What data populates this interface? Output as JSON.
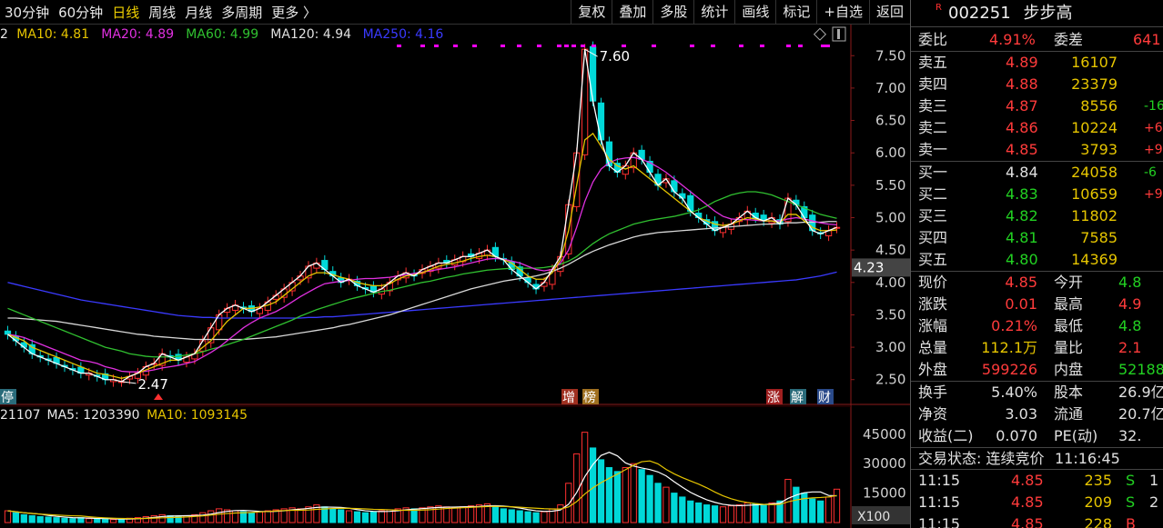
{
  "periods": [
    {
      "label": "30分钟",
      "active": false
    },
    {
      "label": "60分钟",
      "active": false
    },
    {
      "label": "日线",
      "active": true
    },
    {
      "label": "周线",
      "active": false
    },
    {
      "label": "月线",
      "active": false
    },
    {
      "label": "多周期",
      "active": false
    },
    {
      "label": "更多 〉",
      "active": false
    }
  ],
  "toolbar": [
    "复权",
    "叠加",
    "多股",
    "统计",
    "画线",
    "标记",
    "+自选",
    "返回"
  ],
  "ma_legend": [
    {
      "text": "2",
      "color": "#e8e8e8"
    },
    {
      "text": "MA10: 4.81",
      "color": "#e6c500"
    },
    {
      "text": "MA20: 4.89",
      "color": "#e030e0"
    },
    {
      "text": "MA60: 4.99",
      "color": "#30c030"
    },
    {
      "text": "MA120: 4.94",
      "color": "#e0e0e0"
    },
    {
      "text": "MA250: 4.16",
      "color": "#3a3aff"
    }
  ],
  "vol_legend": [
    {
      "text": "21107",
      "color": "#e8e8e8"
    },
    {
      "text": "MA5: 1203390",
      "color": "#e8e8e8"
    },
    {
      "text": "MA10: 1093145",
      "color": "#e6c500"
    }
  ],
  "price_axis": [
    "7.50",
    "7.00",
    "6.50",
    "6.00",
    "5.50",
    "5.00",
    "4.50",
    "4.00",
    "3.50",
    "3.00",
    "2.50"
  ],
  "current_marker": "4.23",
  "vol_axis": [
    "45000",
    "30000",
    "15000"
  ],
  "vol_unit": "X100",
  "annotations": {
    "high": "7.60",
    "low": "2.47",
    "events": [
      "停",
      "增",
      "榜",
      "涨",
      "解",
      "财"
    ]
  },
  "stock": {
    "code": "002251",
    "name": "步步高",
    "badge": "R"
  },
  "order_book": {
    "ratio_label": "委比",
    "ratio_value": "4.91%",
    "diff_label": "委差",
    "diff_value": "641",
    "asks": [
      {
        "label": "卖五",
        "price": "4.89",
        "vol": "16107",
        "chg": ""
      },
      {
        "label": "卖四",
        "price": "4.88",
        "vol": "23379",
        "chg": ""
      },
      {
        "label": "卖三",
        "price": "4.87",
        "vol": "8556",
        "chg": "-16"
      },
      {
        "label": "卖二",
        "price": "4.86",
        "vol": "10224",
        "chg": "+6"
      },
      {
        "label": "卖一",
        "price": "4.85",
        "vol": "3793",
        "chg": "+9"
      }
    ],
    "bids": [
      {
        "label": "买一",
        "price": "4.84",
        "vol": "24058",
        "chg": "-6"
      },
      {
        "label": "买二",
        "price": "4.83",
        "vol": "10659",
        "chg": "+9"
      },
      {
        "label": "买三",
        "price": "4.82",
        "vol": "11802",
        "chg": ""
      },
      {
        "label": "买四",
        "price": "4.81",
        "vol": "7585",
        "chg": ""
      },
      {
        "label": "买五",
        "price": "4.80",
        "vol": "14369",
        "chg": ""
      }
    ]
  },
  "quote": [
    {
      "l1": "现价",
      "v1": "4.85",
      "c1": "red",
      "l2": "今开",
      "v2": "4.8",
      "c2": "green"
    },
    {
      "l1": "涨跌",
      "v1": "0.01",
      "c1": "red",
      "l2": "最高",
      "v2": "4.9",
      "c2": "red"
    },
    {
      "l1": "涨幅",
      "v1": "0.21%",
      "c1": "red",
      "l2": "最低",
      "v2": "4.8",
      "c2": "green"
    },
    {
      "l1": "总量",
      "v1": "112.1万",
      "c1": "yellow",
      "l2": "量比",
      "v2": "2.1",
      "c2": "red"
    },
    {
      "l1": "外盘",
      "v1": "599226",
      "c1": "red",
      "l2": "内盘",
      "v2": "52188",
      "c2": "green"
    }
  ],
  "fundamentals": [
    {
      "l1": "换手",
      "v1": "5.40%",
      "l2": "股本",
      "v2": "26.9亿"
    },
    {
      "l1": "净资",
      "v1": "3.03",
      "l2": "流通",
      "v2": "20.7亿"
    },
    {
      "l1": "收益(二)",
      "v1": "0.070",
      "l2": "PE(动)",
      "v2": "32."
    }
  ],
  "trade_status": {
    "label": "交易状态: 连续竞价",
    "time": "11:16:45"
  },
  "ticks": [
    {
      "time": "11:15",
      "price": "4.85",
      "vol": "235",
      "side": "S",
      "extra": "1"
    },
    {
      "time": "11:15",
      "price": "4.85",
      "vol": "209",
      "side": "S",
      "extra": "2"
    },
    {
      "time": "11:15",
      "price": "4.85",
      "vol": "228",
      "side": "B",
      "extra": ""
    }
  ],
  "chart_data": {
    "type": "candlestick",
    "y_range": [
      2.3,
      7.7
    ],
    "high_label": "7.60",
    "low_label": "2.47",
    "close": [
      3.2,
      3.1,
      3.0,
      2.9,
      2.85,
      2.8,
      2.75,
      2.7,
      2.65,
      2.6,
      2.6,
      2.55,
      2.5,
      2.5,
      2.47,
      2.55,
      2.6,
      2.7,
      2.75,
      2.9,
      2.85,
      2.8,
      2.85,
      2.9,
      3.1,
      3.3,
      3.5,
      3.6,
      3.65,
      3.6,
      3.55,
      3.6,
      3.7,
      3.8,
      3.9,
      4.0,
      4.1,
      4.25,
      4.3,
      4.2,
      4.1,
      4.0,
      4.05,
      3.95,
      3.9,
      3.85,
      3.9,
      4.0,
      4.1,
      4.15,
      4.1,
      4.2,
      4.25,
      4.3,
      4.3,
      4.35,
      4.4,
      4.4,
      4.45,
      4.5,
      4.4,
      4.35,
      4.2,
      4.1,
      4.0,
      3.9,
      4.0,
      4.2,
      4.4,
      5.2,
      6.0,
      7.6,
      6.8,
      6.2,
      5.8,
      5.7,
      5.8,
      6.0,
      5.9,
      5.7,
      5.5,
      5.6,
      5.4,
      5.3,
      5.1,
      5.0,
      4.9,
      4.8,
      4.85,
      4.9,
      5.0,
      5.1,
      5.0,
      4.95,
      5.0,
      4.9,
      5.3,
      5.2,
      5.0,
      4.8,
      4.75,
      4.8,
      4.85
    ],
    "ma10": [
      3.2,
      3.15,
      3.1,
      3.0,
      2.95,
      2.9,
      2.85,
      2.8,
      2.75,
      2.7,
      2.65,
      2.6,
      2.58,
      2.55,
      2.52,
      2.55,
      2.6,
      2.65,
      2.7,
      2.75,
      2.8,
      2.8,
      2.85,
      2.9,
      3.0,
      3.1,
      3.25,
      3.4,
      3.5,
      3.6,
      3.6,
      3.62,
      3.65,
      3.7,
      3.8,
      3.9,
      4.0,
      4.1,
      4.15,
      4.15,
      4.12,
      4.08,
      4.05,
      4.0,
      3.97,
      3.95,
      3.95,
      3.98,
      4.05,
      4.1,
      4.12,
      4.15,
      4.2,
      4.25,
      4.28,
      4.3,
      4.33,
      4.37,
      4.4,
      4.42,
      4.4,
      4.35,
      4.3,
      4.2,
      4.1,
      4.05,
      4.05,
      4.15,
      4.35,
      4.8,
      5.5,
      6.2,
      6.3,
      6.1,
      5.9,
      5.8,
      5.75,
      5.8,
      5.7,
      5.6,
      5.5,
      5.4,
      5.3,
      5.2,
      5.1,
      5.0,
      4.95,
      4.9,
      4.88,
      4.9,
      4.95,
      5.0,
      4.98,
      4.95,
      4.95,
      4.92,
      5.05,
      5.05,
      4.95,
      4.85,
      4.8,
      4.8,
      4.81
    ],
    "ma20": [
      3.2,
      3.18,
      3.15,
      3.1,
      3.05,
      3.0,
      2.95,
      2.9,
      2.85,
      2.8,
      2.78,
      2.75,
      2.7,
      2.67,
      2.63,
      2.62,
      2.62,
      2.63,
      2.65,
      2.68,
      2.7,
      2.72,
      2.75,
      2.78,
      2.85,
      2.92,
      3.0,
      3.1,
      3.2,
      3.3,
      3.38,
      3.45,
      3.5,
      3.55,
      3.62,
      3.7,
      3.78,
      3.85,
      3.92,
      3.98,
      4.0,
      4.02,
      4.03,
      4.05,
      4.06,
      4.06,
      4.07,
      4.08,
      4.1,
      4.12,
      4.14,
      4.16,
      4.18,
      4.2,
      4.22,
      4.24,
      4.27,
      4.3,
      4.33,
      4.36,
      4.37,
      4.36,
      4.33,
      4.3,
      4.25,
      4.2,
      4.18,
      4.2,
      4.3,
      4.5,
      4.85,
      5.25,
      5.55,
      5.75,
      5.85,
      5.9,
      5.92,
      5.93,
      5.9,
      5.85,
      5.78,
      5.7,
      5.6,
      5.5,
      5.4,
      5.3,
      5.2,
      5.1,
      5.02,
      4.98,
      4.97,
      4.97,
      4.96,
      4.95,
      4.95,
      4.95,
      4.98,
      5.0,
      4.98,
      4.95,
      4.92,
      4.9,
      4.89
    ],
    "ma60": [
      3.6,
      3.55,
      3.5,
      3.45,
      3.4,
      3.35,
      3.3,
      3.25,
      3.2,
      3.15,
      3.1,
      3.05,
      3.0,
      2.97,
      2.94,
      2.9,
      2.88,
      2.86,
      2.85,
      2.85,
      2.85,
      2.86,
      2.88,
      2.9,
      2.93,
      2.97,
      3.0,
      3.04,
      3.08,
      3.12,
      3.17,
      3.22,
      3.27,
      3.32,
      3.37,
      3.42,
      3.48,
      3.53,
      3.58,
      3.62,
      3.66,
      3.7,
      3.74,
      3.77,
      3.8,
      3.83,
      3.86,
      3.88,
      3.91,
      3.94,
      3.97,
      4.0,
      4.02,
      4.05,
      4.08,
      4.1,
      4.13,
      4.15,
      4.17,
      4.19,
      4.2,
      4.21,
      4.22,
      4.22,
      4.22,
      4.22,
      4.23,
      4.25,
      4.28,
      4.33,
      4.4,
      4.5,
      4.6,
      4.68,
      4.75,
      4.8,
      4.85,
      4.9,
      4.93,
      4.96,
      4.98,
      5.0,
      5.02,
      5.05,
      5.08,
      5.12,
      5.18,
      5.25,
      5.3,
      5.35,
      5.38,
      5.4,
      5.4,
      5.38,
      5.35,
      5.3,
      5.25,
      5.2,
      5.15,
      5.1,
      5.05,
      5.02,
      4.99
    ],
    "ma120": [
      3.45,
      3.45,
      3.44,
      3.43,
      3.42,
      3.41,
      3.4,
      3.38,
      3.36,
      3.34,
      3.32,
      3.3,
      3.28,
      3.26,
      3.24,
      3.22,
      3.2,
      3.19,
      3.17,
      3.16,
      3.15,
      3.14,
      3.13,
      3.12,
      3.12,
      3.12,
      3.12,
      3.12,
      3.12,
      3.12,
      3.13,
      3.14,
      3.15,
      3.16,
      3.18,
      3.2,
      3.22,
      3.24,
      3.26,
      3.28,
      3.3,
      3.33,
      3.35,
      3.38,
      3.41,
      3.44,
      3.47,
      3.5,
      3.54,
      3.58,
      3.62,
      3.66,
      3.7,
      3.74,
      3.78,
      3.82,
      3.86,
      3.9,
      3.93,
      3.96,
      3.99,
      4.02,
      4.04,
      4.06,
      4.08,
      4.1,
      4.13,
      4.17,
      4.22,
      4.28,
      4.35,
      4.42,
      4.48,
      4.53,
      4.58,
      4.62,
      4.66,
      4.7,
      4.73,
      4.75,
      4.77,
      4.78,
      4.79,
      4.8,
      4.81,
      4.82,
      4.83,
      4.84,
      4.85,
      4.86,
      4.87,
      4.88,
      4.89,
      4.9,
      4.9,
      4.91,
      4.92,
      4.92,
      4.93,
      4.93,
      4.93,
      4.94,
      4.94
    ],
    "ma250": [
      4.0,
      3.97,
      3.94,
      3.91,
      3.88,
      3.85,
      3.82,
      3.79,
      3.76,
      3.73,
      3.71,
      3.69,
      3.67,
      3.65,
      3.63,
      3.61,
      3.59,
      3.57,
      3.55,
      3.53,
      3.51,
      3.49,
      3.48,
      3.47,
      3.46,
      3.46,
      3.45,
      3.45,
      3.45,
      3.45,
      3.45,
      3.45,
      3.45,
      3.45,
      3.45,
      3.45,
      3.45,
      3.46,
      3.46,
      3.47,
      3.47,
      3.48,
      3.49,
      3.5,
      3.51,
      3.52,
      3.53,
      3.54,
      3.55,
      3.56,
      3.57,
      3.58,
      3.59,
      3.6,
      3.61,
      3.62,
      3.63,
      3.64,
      3.65,
      3.66,
      3.67,
      3.68,
      3.69,
      3.7,
      3.71,
      3.72,
      3.73,
      3.74,
      3.75,
      3.76,
      3.77,
      3.78,
      3.79,
      3.8,
      3.81,
      3.82,
      3.83,
      3.84,
      3.85,
      3.86,
      3.87,
      3.88,
      3.89,
      3.9,
      3.91,
      3.92,
      3.93,
      3.94,
      3.95,
      3.96,
      3.97,
      3.98,
      3.99,
      4.0,
      4.01,
      4.02,
      4.03,
      4.04,
      4.06,
      4.08,
      4.1,
      4.13,
      4.16
    ],
    "volume": [
      6000,
      5000,
      4000,
      3500,
      3000,
      2800,
      2500,
      2200,
      2000,
      2500,
      2000,
      1800,
      1700,
      1500,
      1800,
      2200,
      2500,
      3000,
      3500,
      4000,
      3500,
      3000,
      3500,
      4000,
      5000,
      6000,
      7000,
      6500,
      6000,
      5500,
      5000,
      5500,
      6000,
      6500,
      7000,
      7500,
      7000,
      8000,
      9000,
      8000,
      7000,
      6500,
      6000,
      5500,
      5000,
      5500,
      6000,
      6500,
      7000,
      7500,
      7000,
      7500,
      8000,
      8500,
      8000,
      7500,
      8000,
      8500,
      9000,
      9500,
      8000,
      7000,
      6500,
      6000,
      5500,
      5000,
      5500,
      7000,
      9000,
      20000,
      35000,
      46000,
      38000,
      32000,
      28000,
      26000,
      28000,
      30000,
      27000,
      24000,
      20000,
      18000,
      15000,
      13000,
      11000,
      10000,
      9000,
      8500,
      8000,
      8500,
      9000,
      10000,
      9500,
      9000,
      10000,
      11000,
      22000,
      18000,
      15000,
      12000,
      11000,
      13000,
      17000
    ]
  }
}
